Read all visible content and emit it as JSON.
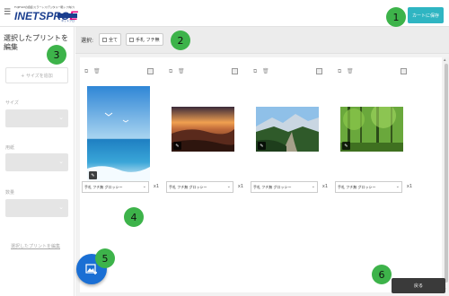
{
  "header": {
    "menu_icon": "hamburger-icon",
    "logo": {
      "tagline": "FUJIFILMの認証(ミラーレス/デジタル一眼レフ向け)",
      "brand": "NETSPRO",
      "brand_i": "I",
      "brand_e": "E",
      "sub": "ネットプロ"
    },
    "cart_button": "カートに保存"
  },
  "sidebar": {
    "title": "選択したプリントを編集",
    "add_size": "+ サイズを追加",
    "size_label": "サイズ",
    "paper_label": "用紙",
    "count_label": "数量",
    "apply_link": "選択したプリントを編集"
  },
  "filter": {
    "label": "選択:",
    "all": "全て",
    "handmade": "手札 フチ無"
  },
  "cards": [
    {
      "option": "手札 フチ無 グロッシー",
      "qty": "x1"
    },
    {
      "option": "手札 フチ無 グロッシー",
      "qty": "x1"
    },
    {
      "option": "手札 フチ無 グロッシー",
      "qty": "x1"
    },
    {
      "option": "手札 フチ無 グロッシー",
      "qty": "x1"
    }
  ],
  "footer": {
    "return_button": "戻る",
    "add_photo_icon": "add-photo-icon"
  },
  "annotations": [
    "1",
    "2",
    "3",
    "4",
    "5",
    "6"
  ],
  "colors": {
    "accent": "#2fb5c2",
    "fab": "#1a6fd4",
    "badge": "#3db34a"
  }
}
